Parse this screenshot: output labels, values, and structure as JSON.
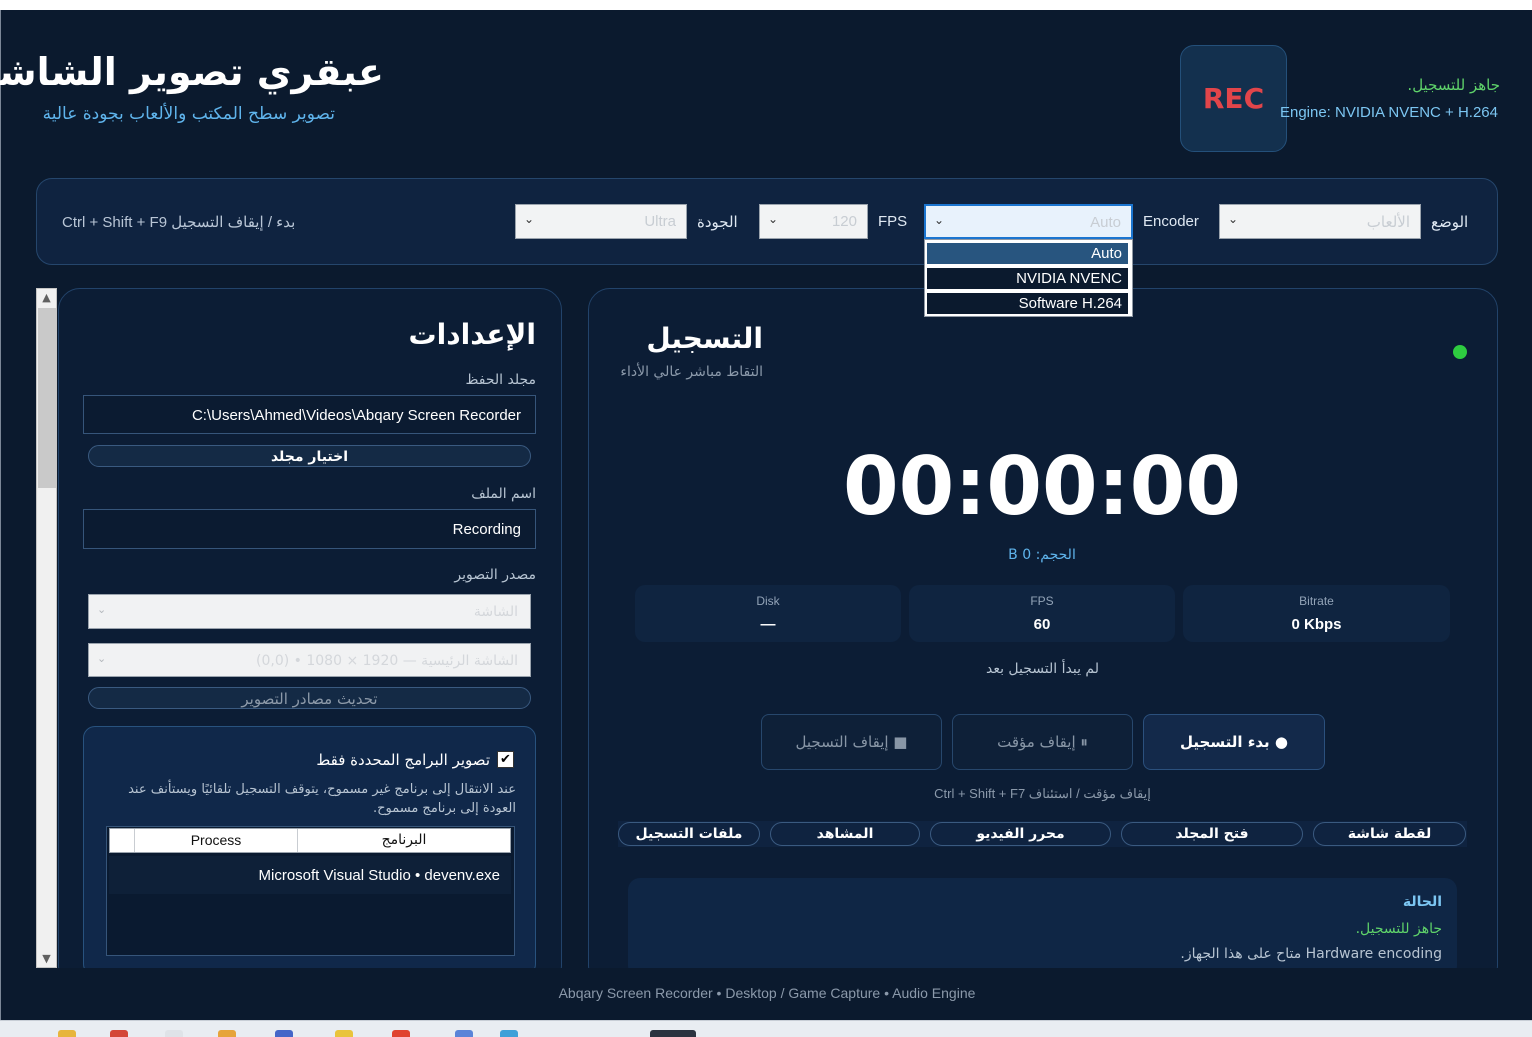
{
  "header": {
    "title": "عبقري تصوير الشاشة",
    "subtitle": "تصوير سطح المكتب والألعاب بجودة عالية",
    "rec_badge": "REC",
    "status": "جاهز للتسجيل.",
    "engine": "Engine: NVIDIA NVENC + H.264"
  },
  "toolbar": {
    "mode_label": "الوضع",
    "mode_value": "الألعاب",
    "encoder_label": "Encoder",
    "encoder_value": "Auto",
    "fps_label": "FPS",
    "fps_value": "120",
    "quality_label": "الجودة",
    "quality_value": "Ultra",
    "hotkey_hint": "Ctrl + Shift + F9 بدء / إيقاف التسجيل"
  },
  "encoder_dropdown": {
    "options": [
      "Auto",
      "NVIDIA NVENC",
      "Software H.264"
    ],
    "selected_index": 0
  },
  "settings": {
    "title": "الإعدادات",
    "folder_label": "مجلد الحفظ",
    "folder_value": "C:\\Users\\Ahmed\\Videos\\Abqary Screen Recorder",
    "choose_folder": "اختيار مجلد",
    "filename_label": "اسم الملف",
    "filename_value": "Recording",
    "source_label": "مصدر التصوير",
    "source_value": "الشاشة",
    "monitor_value": "الشاشة الرئيسية — 1920 × 1080 • (0,0)",
    "refresh_sources": "تحديث مصادر التصوير",
    "only_apps_label": "تصوير البرامج المحددة فقط",
    "only_apps_checked": true,
    "only_apps_desc": "عند الانتقال إلى برنامج غير مسموح، يتوقف التسجيل تلقائيًا ويستأنف عند العودة إلى برنامج مسموح.",
    "apps_table": {
      "columns": [
        "البرنامج",
        "Process"
      ],
      "rows": [
        "Microsoft Visual Studio • devenv.exe"
      ]
    }
  },
  "recording": {
    "title": "التسجيل",
    "subtitle": "التقاط مباشر عالي الأداء",
    "timer": "00:00:00",
    "size": "الحجم: 0 B",
    "stats": [
      {
        "key": "Bitrate",
        "value": "0 Kbps"
      },
      {
        "key": "FPS",
        "value": "60"
      },
      {
        "key": "Disk",
        "value": "—"
      }
    ],
    "state_text": "لم يبدأ التسجيل بعد",
    "start_button": "● بدء التسجيل",
    "pause_button": "⏸ إيقاف مؤقت",
    "stop_button": "■ إيقاف التسجيل",
    "pause_hint": "Ctrl + Shift + F7 إيقاف مؤقت / استئناف",
    "tools": [
      "لقطة شاشة",
      "فتح المجلد",
      "محرر الفيديو",
      "المشاهد",
      "ملفات التسجيل"
    ],
    "status_title": "الحالة",
    "status_ready": "جاهز للتسجيل.",
    "status_hw": "Hardware encoding متاح على هذا الجهاز."
  },
  "footer": "Abqary Screen Recorder • Desktop / Game Capture • Audio Engine",
  "colors": {
    "background": "#0b1a2e",
    "accent_blue": "#5fb4ec",
    "ready_green": "#5fd36a",
    "rec_red": "#e2454a",
    "live_dot": "#2ecc40"
  }
}
